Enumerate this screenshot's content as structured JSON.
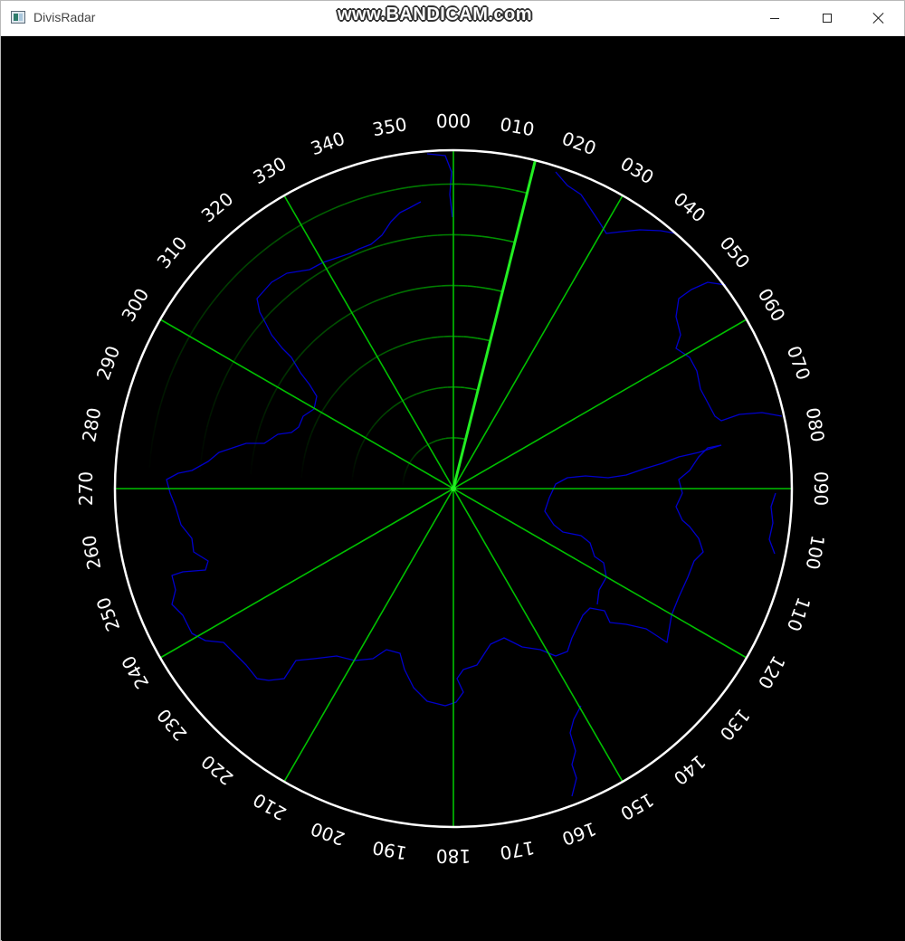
{
  "window": {
    "title": "DivisRadar",
    "watermark": "www.BANDICAM.com",
    "controls": {
      "minimize": "minimize-icon",
      "maximize": "maximize-icon",
      "close": "close-icon"
    }
  },
  "radar": {
    "bearing_labels": [
      "000",
      "010",
      "020",
      "030",
      "040",
      "050",
      "060",
      "070",
      "080",
      "090",
      "100",
      "110",
      "120",
      "130",
      "140",
      "150",
      "160",
      "170",
      "180",
      "190",
      "200",
      "210",
      "220",
      "230",
      "240",
      "250",
      "260",
      "270",
      "280",
      "290",
      "300",
      "310",
      "320",
      "330",
      "340",
      "350"
    ],
    "spoke_bearings_deg": [
      0,
      30,
      60,
      90,
      120,
      150,
      180,
      210,
      240,
      270,
      300,
      330
    ],
    "sweep_bearing_deg": 14,
    "range_ring_fraction": [
      0.15,
      0.3,
      0.45,
      0.6,
      0.75,
      0.9
    ],
    "trail_span_deg": 100,
    "colors": {
      "background": "#000000",
      "outer_ring": "#ffffff",
      "spokes": "#00c000",
      "sweep": "#22ee22",
      "rings": "#00a000",
      "coastline": "#0000cc",
      "labels": "#ffffff"
    }
  }
}
